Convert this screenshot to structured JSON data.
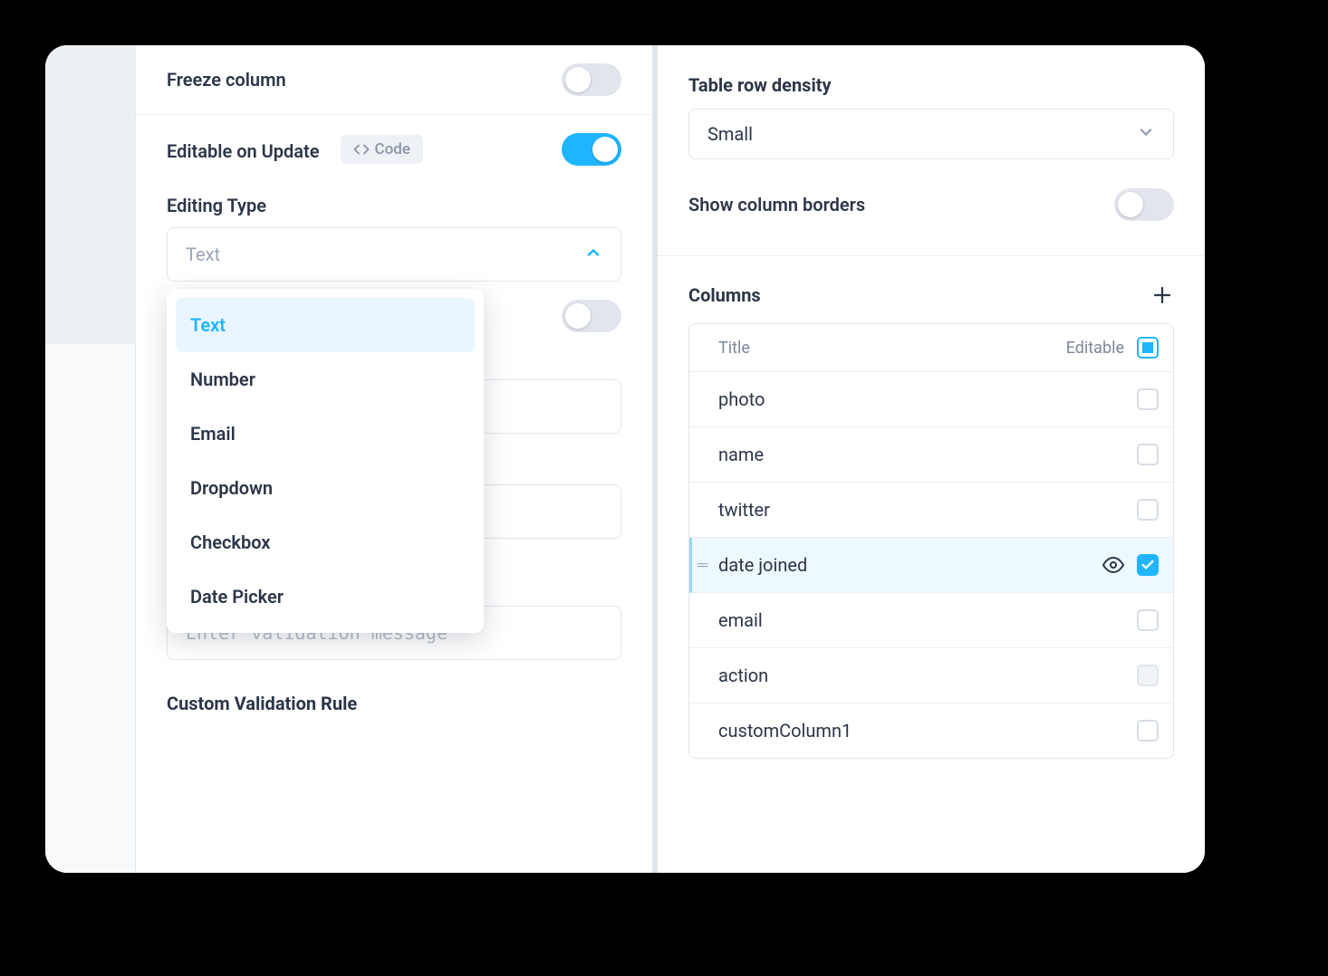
{
  "left": {
    "freeze_column": {
      "label": "Freeze column",
      "on": false
    },
    "editable_on_update": {
      "label": "Editable on Update",
      "on": true,
      "code_chip": "Code"
    },
    "editing_type": {
      "label": "Editing Type",
      "value": "Text",
      "options": [
        "Text",
        "Number",
        "Email",
        "Dropdown",
        "Checkbox",
        "Date Picker"
      ]
    },
    "ghost_toggle": {
      "on": false
    },
    "validation_placeholder": "Enter validation message",
    "custom_validation_label": "Custom Validation Rule"
  },
  "right": {
    "row_density": {
      "label": "Table row density",
      "value": "Small"
    },
    "show_borders": {
      "label": "Show column borders",
      "on": false
    },
    "columns": {
      "title": "Columns",
      "header_title": "Title",
      "header_editable": "Editable",
      "header_checkbox_state": "indeterminate",
      "items": [
        {
          "name": "photo",
          "editable": false,
          "selected": false
        },
        {
          "name": "name",
          "editable": false,
          "selected": false
        },
        {
          "name": "twitter",
          "editable": false,
          "selected": false
        },
        {
          "name": "date joined",
          "editable": true,
          "selected": true,
          "show_eye": true
        },
        {
          "name": "email",
          "editable": false,
          "selected": false
        },
        {
          "name": "action",
          "editable": false,
          "selected": false,
          "disabled": true
        },
        {
          "name": "customColumn1",
          "editable": false,
          "selected": false
        }
      ]
    }
  }
}
